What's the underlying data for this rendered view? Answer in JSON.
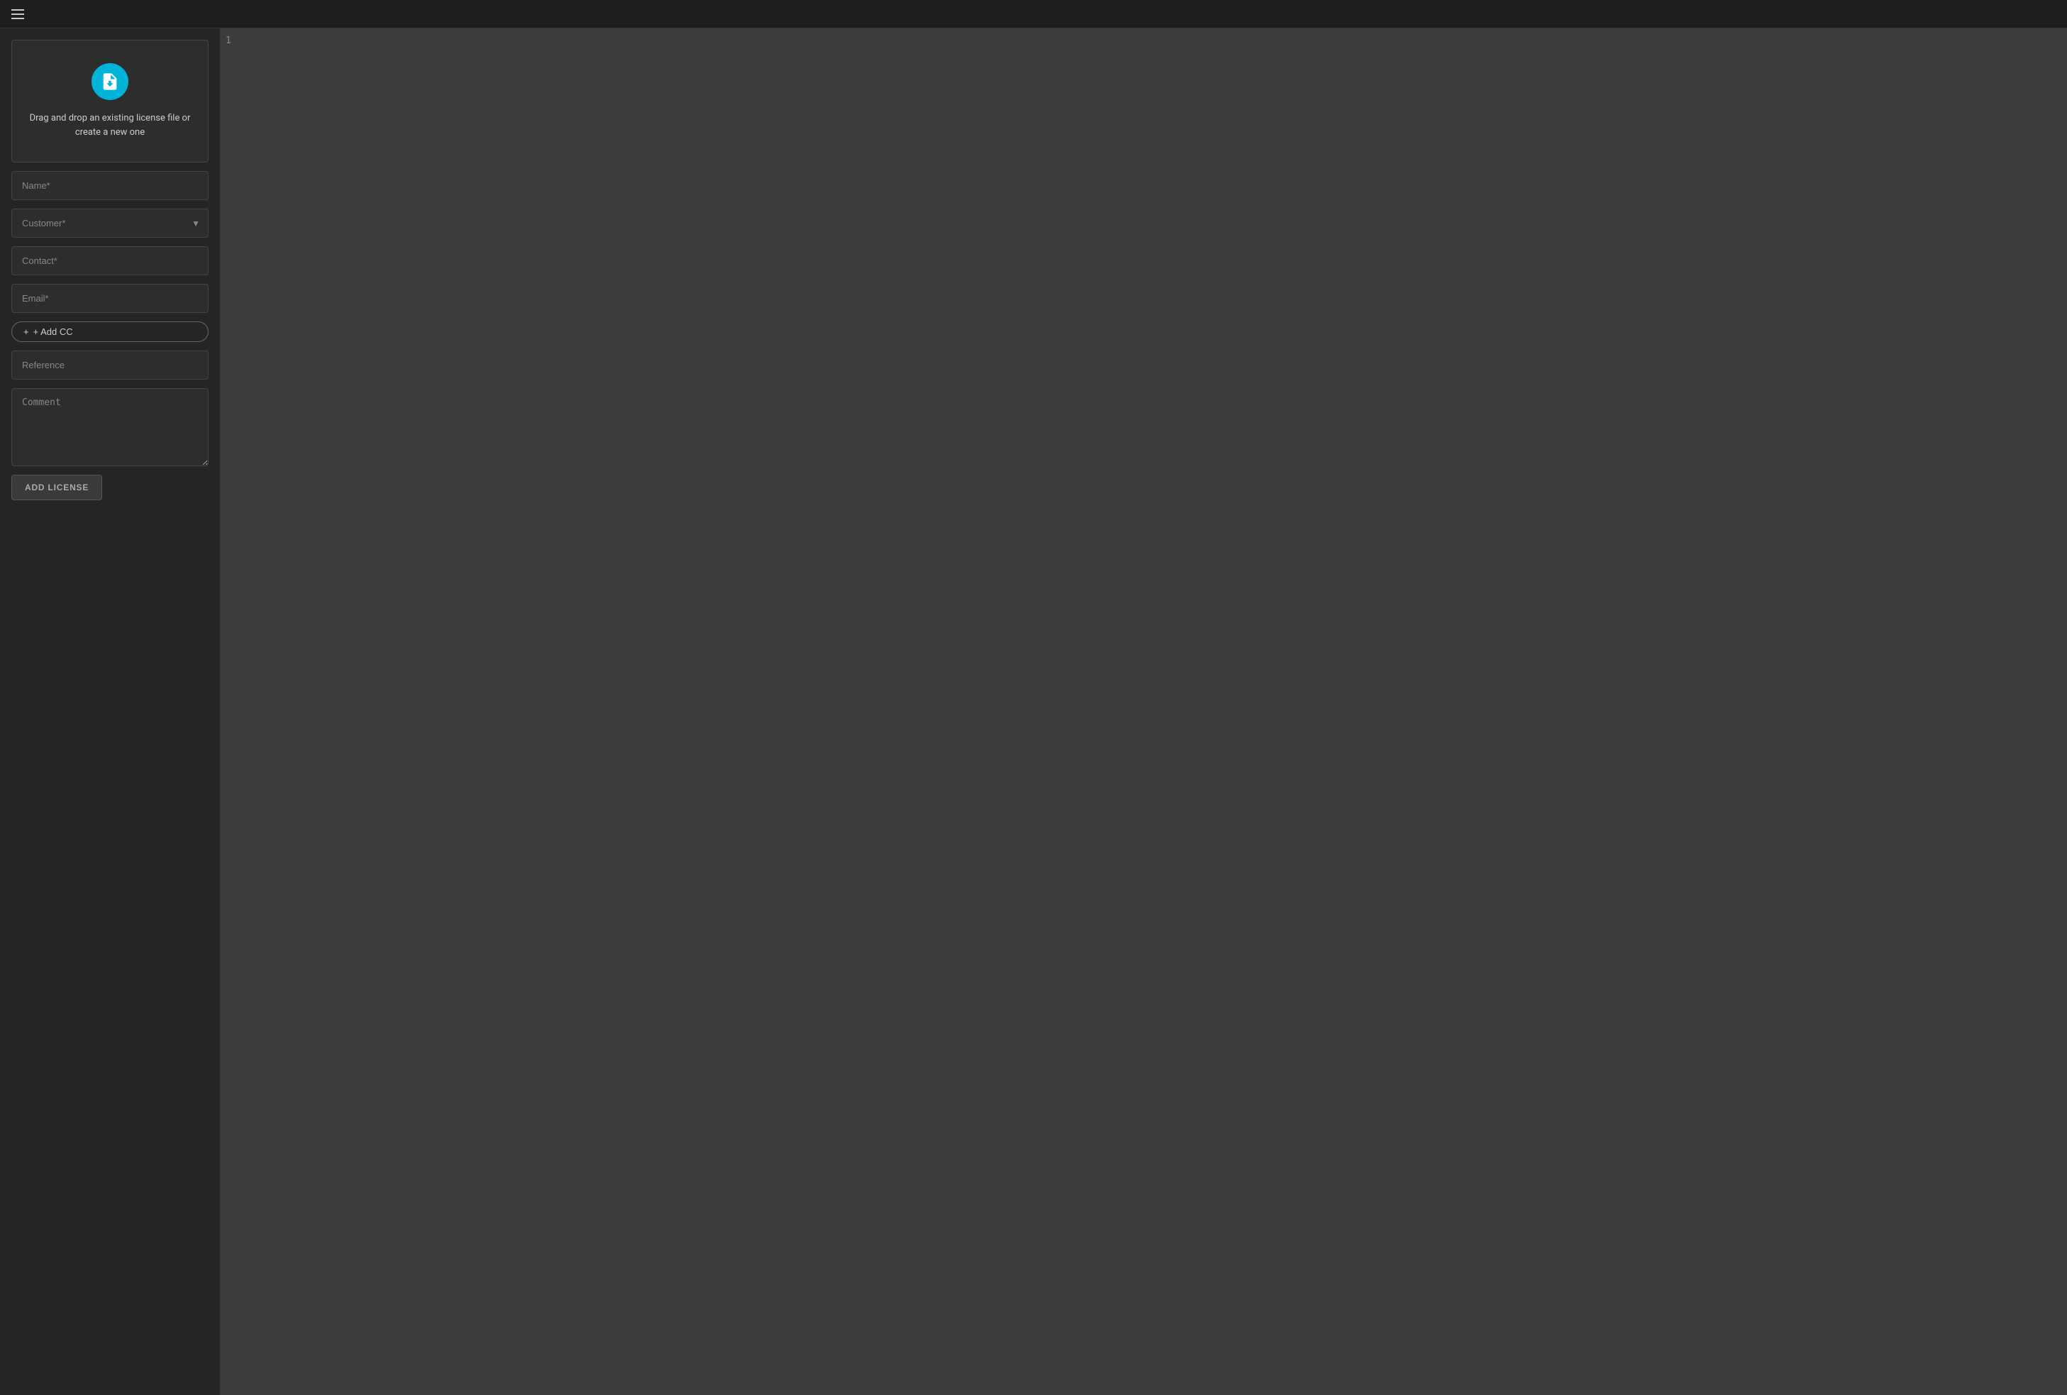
{
  "topbar": {
    "menu_icon": "hamburger-icon"
  },
  "left_panel": {
    "dropzone": {
      "icon": "upload-file-icon",
      "text": "Drag and drop an existing license file or create a new one"
    },
    "fields": {
      "name_placeholder": "Name*",
      "customer_placeholder": "Customer*",
      "contact_placeholder": "Contact*",
      "email_placeholder": "Email*",
      "reference_placeholder": "Reference",
      "comment_placeholder": "Comment"
    },
    "add_cc_label": "+ Add CC",
    "add_license_label": "ADD LICENSE"
  },
  "right_panel": {
    "line_number": "1"
  }
}
